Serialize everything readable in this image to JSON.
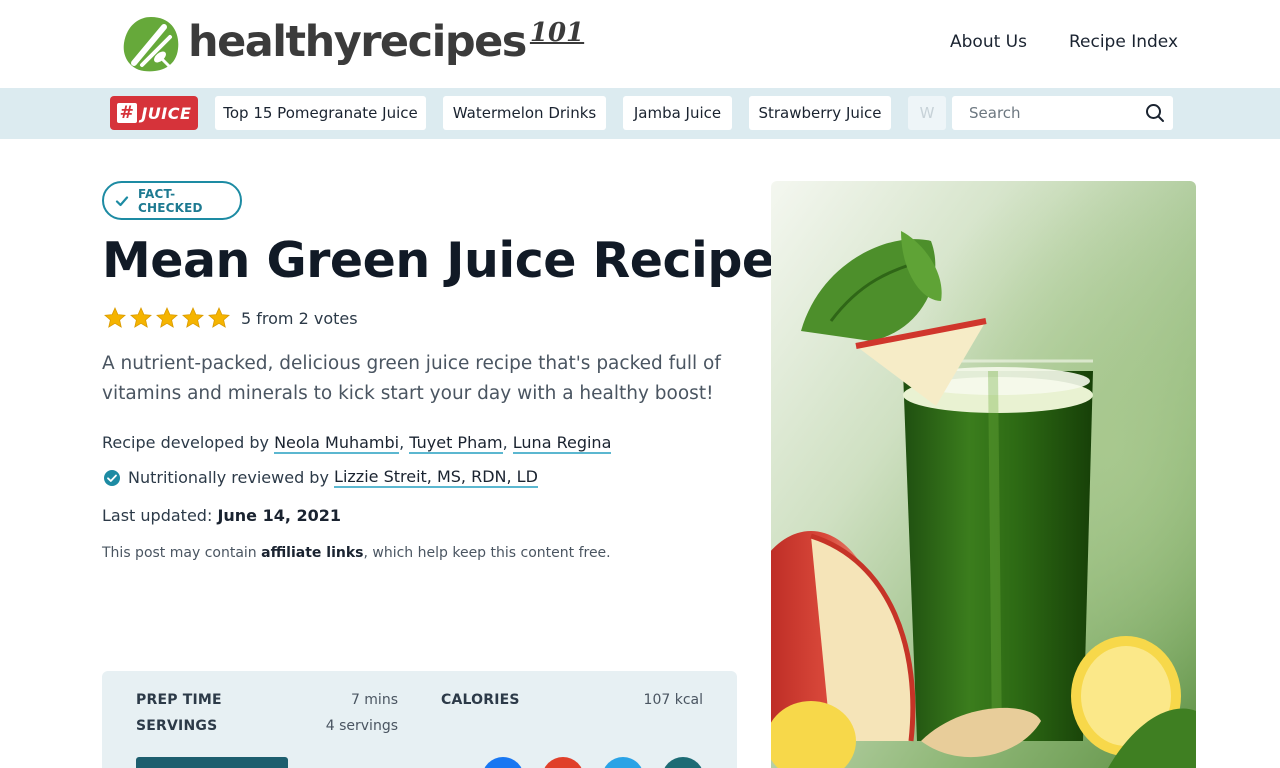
{
  "brand": {
    "name": "healthyrecipes",
    "suffix": "101",
    "green": "#66a93a",
    "text_color": "#3b3b3b"
  },
  "top_nav": [
    {
      "label": "About Us"
    },
    {
      "label": "Recipe Index"
    }
  ],
  "topic_bar": {
    "tag_hash": "#",
    "tag_label": "JUICE",
    "chips": [
      {
        "label": "Top 15 Pomegranate Juice"
      },
      {
        "label": "Watermelon Drinks"
      },
      {
        "label": "Jamba Juice"
      },
      {
        "label": "Strawberry Juice"
      },
      {
        "label": "W"
      }
    ],
    "search_placeholder": "Search",
    "search_icon": "search-icon"
  },
  "article": {
    "badge": "FACT-CHECKED",
    "title": "Mean Green Juice Recipe",
    "rating_value": 5,
    "rating_text": "5 from 2 votes",
    "description": "A nutrient-packed, delicious green juice recipe that's packed full of vitamins and minerals to kick start your day with a healthy boost!",
    "developed_prefix": "Recipe developed by",
    "developers": [
      "Neola Muhambi",
      "Tuyet Pham",
      "Luna Regina"
    ],
    "reviewed_prefix": "Nutritionally reviewed by",
    "reviewer": "Lizzie Streit, MS, RDN, LD",
    "updated_prefix": "Last updated:",
    "updated_date": "June 14, 2021",
    "disclosure_before": "This post may contain",
    "disclosure_link": "affiliate links",
    "disclosure_after": ", which help keep this content free."
  },
  "recipe_info": {
    "prep_time_label": "PREP TIME",
    "prep_time_value": "7 mins",
    "servings_label": "SERVINGS",
    "servings_value": "4 servings",
    "calories_label": "CALORIES",
    "calories_value": "107 kcal"
  },
  "colors": {
    "accent": "#1d8ba3",
    "link_underline": "#5bb7d0",
    "topic_bar_bg": "#dcebf0",
    "tag_red": "#d6333a",
    "star": "#f5b400",
    "info_bg": "#e7f0f3"
  }
}
